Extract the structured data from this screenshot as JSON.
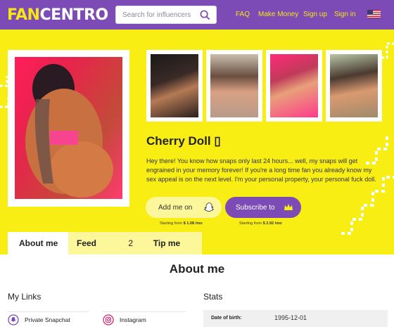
{
  "header": {
    "logo_fan": "FAN",
    "logo_centro": "CENTRO",
    "search_placeholder": "Search for influencers",
    "nav": {
      "faq": "FAQ",
      "make_money": "Make Money",
      "sign_up": "Sign up",
      "sign_in": "Sign in"
    },
    "language": "US"
  },
  "colors": {
    "purple": "#7d4bb5",
    "yellow": "#f9ee14",
    "pale_yellow": "#fbf79a"
  },
  "profile": {
    "name": "Cherry Doll ▯",
    "bio": "Hey there! You know how snaps only last 24 hours... well, my snaps will get engrained in your memory forever! If you're a long time fan you already know my sex appeal is on the next level. I'm your personal property, your personal fuck doll.",
    "thumbnails": 4
  },
  "actions": {
    "add_label": "Add me on",
    "add_price_prefix": "Starting from ",
    "add_price": "$ 1.08 /mo",
    "subscribe_label": "Subscribe to",
    "subscribe_price_prefix": "Starting from ",
    "subscribe_price": "$ 2.92 /mo"
  },
  "tabs": {
    "about": "About me",
    "feed": "Feed",
    "feed_count": "2",
    "tip": "Tip me"
  },
  "about": {
    "title": "About me",
    "links_title": "My Links",
    "links": [
      {
        "label": "Private Snapchat",
        "icon": "snapchat-private-icon"
      },
      {
        "label": "Instagram",
        "icon": "instagram-icon"
      }
    ],
    "stats_title": "Stats",
    "stats": [
      {
        "key": "Date of birth:",
        "value": "1995-12-01"
      }
    ]
  }
}
